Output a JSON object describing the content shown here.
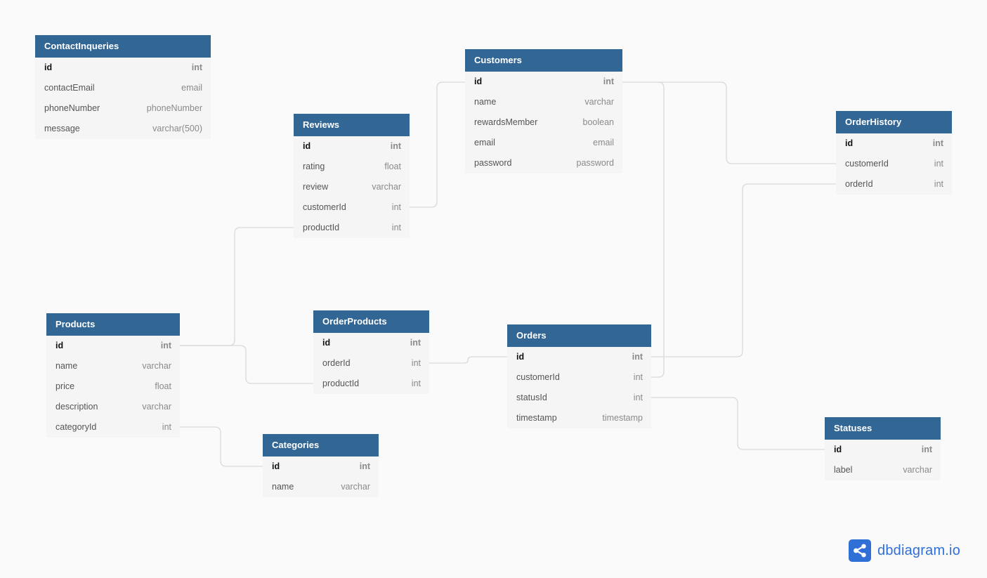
{
  "tables": [
    {
      "id": "contactinquiries",
      "name": "ContactInqueries",
      "fields": [
        {
          "name": "id",
          "type": "int",
          "pk": true
        },
        {
          "name": "contactEmail",
          "type": "email"
        },
        {
          "name": "phoneNumber",
          "type": "phoneNumber"
        },
        {
          "name": "message",
          "type": "varchar(500)"
        }
      ]
    },
    {
      "id": "customers",
      "name": "Customers",
      "fields": [
        {
          "name": "id",
          "type": "int",
          "pk": true
        },
        {
          "name": "name",
          "type": "varchar"
        },
        {
          "name": "rewardsMember",
          "type": "boolean"
        },
        {
          "name": "email",
          "type": "email"
        },
        {
          "name": "password",
          "type": "password"
        }
      ]
    },
    {
      "id": "reviews",
      "name": "Reviews",
      "fields": [
        {
          "name": "id",
          "type": "int",
          "pk": true
        },
        {
          "name": "rating",
          "type": "float"
        },
        {
          "name": "review",
          "type": "varchar"
        },
        {
          "name": "customerId",
          "type": "int"
        },
        {
          "name": "productId",
          "type": "int"
        }
      ]
    },
    {
      "id": "orderhistory",
      "name": "OrderHistory",
      "fields": [
        {
          "name": "id",
          "type": "int",
          "pk": true
        },
        {
          "name": "customerId",
          "type": "int"
        },
        {
          "name": "orderId",
          "type": "int"
        }
      ]
    },
    {
      "id": "products",
      "name": "Products",
      "fields": [
        {
          "name": "id",
          "type": "int",
          "pk": true
        },
        {
          "name": "name",
          "type": "varchar"
        },
        {
          "name": "price",
          "type": "float"
        },
        {
          "name": "description",
          "type": "varchar"
        },
        {
          "name": "categoryId",
          "type": "int"
        }
      ]
    },
    {
      "id": "orderproducts",
      "name": "OrderProducts",
      "fields": [
        {
          "name": "id",
          "type": "int",
          "pk": true
        },
        {
          "name": "orderId",
          "type": "int"
        },
        {
          "name": "productId",
          "type": "int"
        }
      ]
    },
    {
      "id": "orders",
      "name": "Orders",
      "fields": [
        {
          "name": "id",
          "type": "int",
          "pk": true
        },
        {
          "name": "customerId",
          "type": "int"
        },
        {
          "name": "statusId",
          "type": "int"
        },
        {
          "name": "timestamp",
          "type": "timestamp"
        }
      ]
    },
    {
      "id": "categories",
      "name": "Categories",
      "fields": [
        {
          "name": "id",
          "type": "int",
          "pk": true
        },
        {
          "name": "name",
          "type": "varchar"
        }
      ]
    },
    {
      "id": "statuses",
      "name": "Statuses",
      "fields": [
        {
          "name": "id",
          "type": "int",
          "pk": true
        },
        {
          "name": "label",
          "type": "varchar"
        }
      ]
    }
  ],
  "relationships": [
    {
      "from": "Reviews.customerId",
      "to": "Customers.id"
    },
    {
      "from": "Reviews.productId",
      "to": "Products.id"
    },
    {
      "from": "OrderHistory.customerId",
      "to": "Customers.id"
    },
    {
      "from": "OrderHistory.orderId",
      "to": "Orders.id"
    },
    {
      "from": "Orders.customerId",
      "to": "Customers.id"
    },
    {
      "from": "OrderProducts.orderId",
      "to": "Orders.id"
    },
    {
      "from": "OrderProducts.productId",
      "to": "Products.id"
    },
    {
      "from": "Products.categoryId",
      "to": "Categories.id"
    },
    {
      "from": "Orders.statusId",
      "to": "Statuses.id"
    }
  ],
  "brand": {
    "name": "dbdiagram.io",
    "icon": "share-nodes-icon",
    "color": "#2f6fd6"
  },
  "colors": {
    "header": "#326694",
    "body": "#f5f5f5",
    "canvas": "#fafafa",
    "link": "#d9d9d9"
  }
}
